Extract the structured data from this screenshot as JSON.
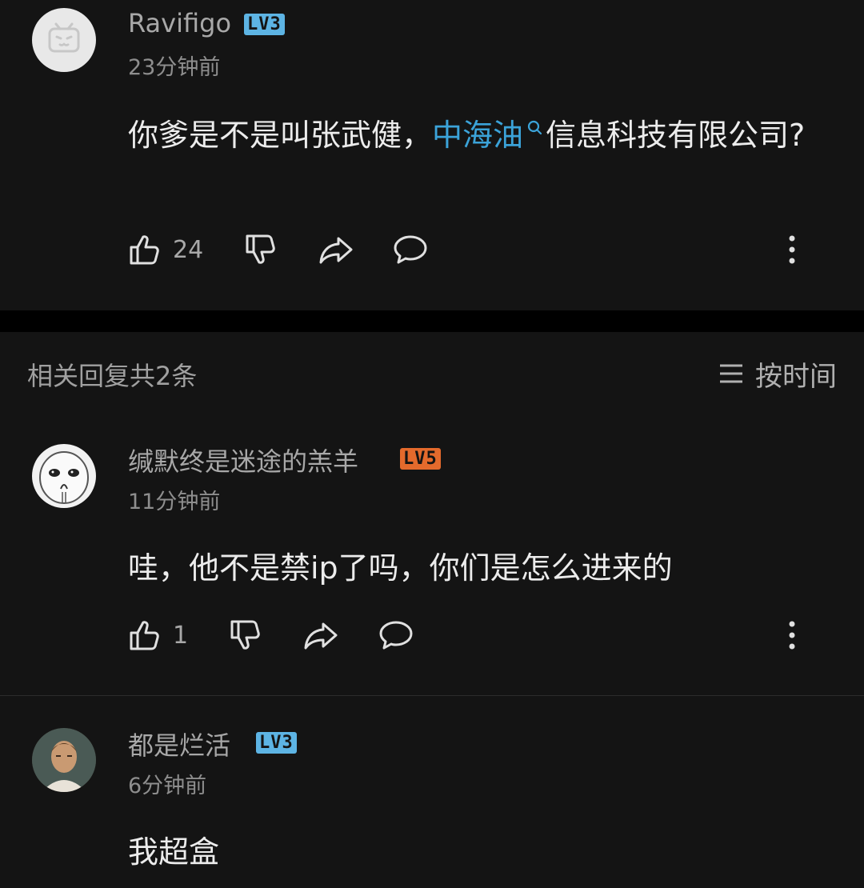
{
  "comments": [
    {
      "username": "Ravifigo",
      "level": "LV3",
      "level_color": "#5db4e4",
      "time": "23分钟前",
      "content_before": "你爹是不是叫张武健，",
      "link_text": "中海油",
      "content_after": "信息科技有限公司?",
      "likes": "24"
    }
  ],
  "replies_header": {
    "label": "相关回复共2条",
    "sort_label": "按时间"
  },
  "replies": [
    {
      "username": "缄默终是迷途的羔羊",
      "level": "LV5",
      "level_color": "#e46a2c",
      "time": "11分钟前",
      "content": "哇，他不是禁ip了吗，你们是怎么进来的",
      "likes": "1"
    },
    {
      "username": "都是烂活",
      "level": "LV3",
      "level_color": "#5db4e4",
      "time": "6分钟前",
      "content": "我超盒"
    }
  ],
  "icons": {
    "like": "thumbs-up-icon",
    "dislike": "thumbs-down-icon",
    "share": "share-icon",
    "reply": "comment-bubble-icon",
    "more": "more-vertical-icon",
    "sort": "menu-lines-icon",
    "search": "search-icon"
  }
}
